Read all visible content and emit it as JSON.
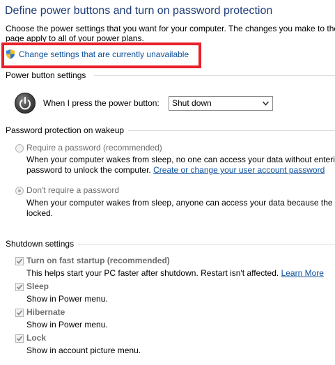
{
  "header": {
    "title": "Define power buttons and turn on password protection",
    "intro_line1": "Choose the power settings that you want for your computer. The changes you make to the",
    "intro_line2": "page apply to all of your power plans.",
    "change_settings_link": "Change settings that are currently unavailable"
  },
  "power_button": {
    "section_label": "Power button settings",
    "label": "When I press the power button:",
    "selected_value": "Shut down"
  },
  "password": {
    "section_label": "Password protection on wakeup",
    "require_label": "Require a password (recommended)",
    "require_desc1": "When your computer wakes from sleep, no one can access your data without enterin",
    "require_desc2": "password to unlock the computer.",
    "require_link": "Create or change your user account password",
    "dont_label": "Don't require a password",
    "dont_desc1": "When your computer wakes from sleep, anyone can access your data because the co",
    "dont_desc2": "locked."
  },
  "shutdown": {
    "section_label": "Shutdown settings",
    "fast_startup_label": "Turn on fast startup (recommended)",
    "fast_startup_desc": "This helps start your PC faster after shutdown. Restart isn't affected.",
    "learn_more": "Learn More",
    "sleep_label": "Sleep",
    "sleep_desc": "Show in Power menu.",
    "hibernate_label": "Hibernate",
    "hibernate_desc": "Show in Power menu.",
    "lock_label": "Lock",
    "lock_desc": "Show in account picture menu."
  },
  "colors": {
    "title": "#1e3c78",
    "link": "#0b4f9c",
    "highlight_border": "#e8202a",
    "disabled_text": "#6d6d6d"
  }
}
